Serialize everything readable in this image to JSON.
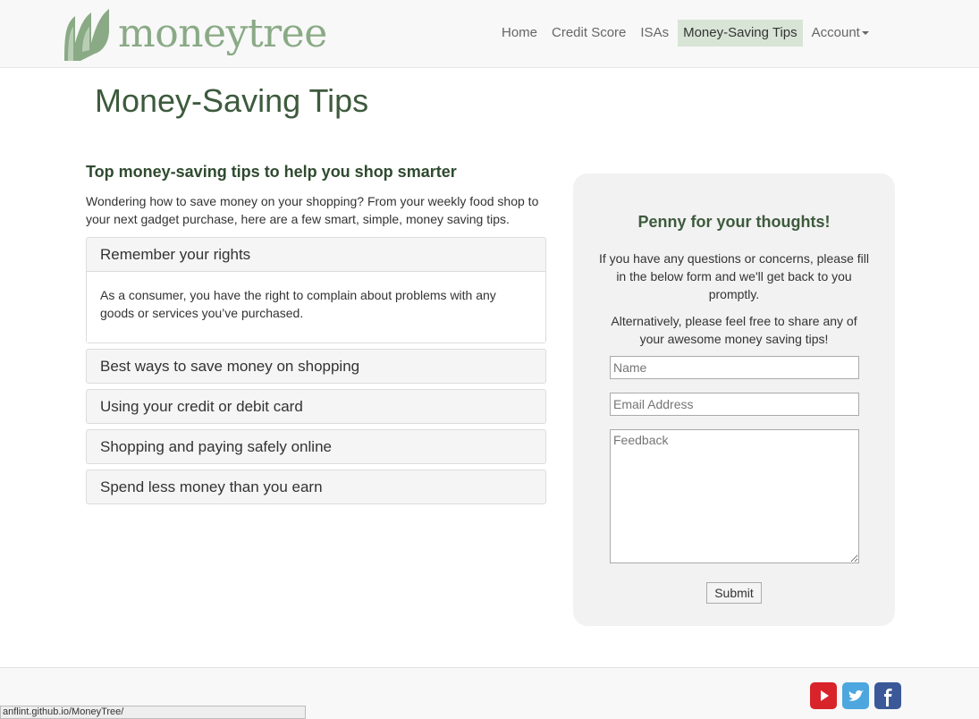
{
  "brand": {
    "name": "moneytree",
    "color": "#8aaa86"
  },
  "nav": {
    "items": [
      {
        "label": "Home",
        "active": false
      },
      {
        "label": "Credit Score",
        "active": false
      },
      {
        "label": "ISAs",
        "active": false
      },
      {
        "label": "Money-Saving Tips",
        "active": true
      },
      {
        "label": "Account",
        "active": false,
        "dropdown": true
      }
    ]
  },
  "page": {
    "title": "Money-Saving Tips"
  },
  "tips": {
    "heading": "Top money-saving tips to help you shop smarter",
    "intro": "Wondering how to save money on your shopping? From your weekly food shop to your next gadget purchase, here are a few smart, simple, money saving tips.",
    "panels": [
      {
        "title": "Remember your rights",
        "expanded": true,
        "body": "As a consumer, you have the right to complain about problems with any goods or services you’ve purchased."
      },
      {
        "title": "Best ways to save money on shopping",
        "expanded": false
      },
      {
        "title": "Using your credit or debit card",
        "expanded": false
      },
      {
        "title": "Shopping and paying safely online",
        "expanded": false
      },
      {
        "title": "Spend less money than you earn",
        "expanded": false
      }
    ]
  },
  "feedback": {
    "title": "Penny for your thoughts!",
    "text1": "If you have any questions or concerns, please fill in the below form and we'll get back to you promptly.",
    "text2": "Alternatively, please feel free to share any of your awesome money saving tips!",
    "name_placeholder": "Name",
    "email_placeholder": "Email Address",
    "feedback_placeholder": "Feedback",
    "submit_label": "Submit"
  },
  "footer": {
    "social": [
      "youtube-icon",
      "twitter-icon",
      "facebook-icon"
    ]
  },
  "statusbar": {
    "url": "anflint.github.io/MoneyTree/"
  }
}
